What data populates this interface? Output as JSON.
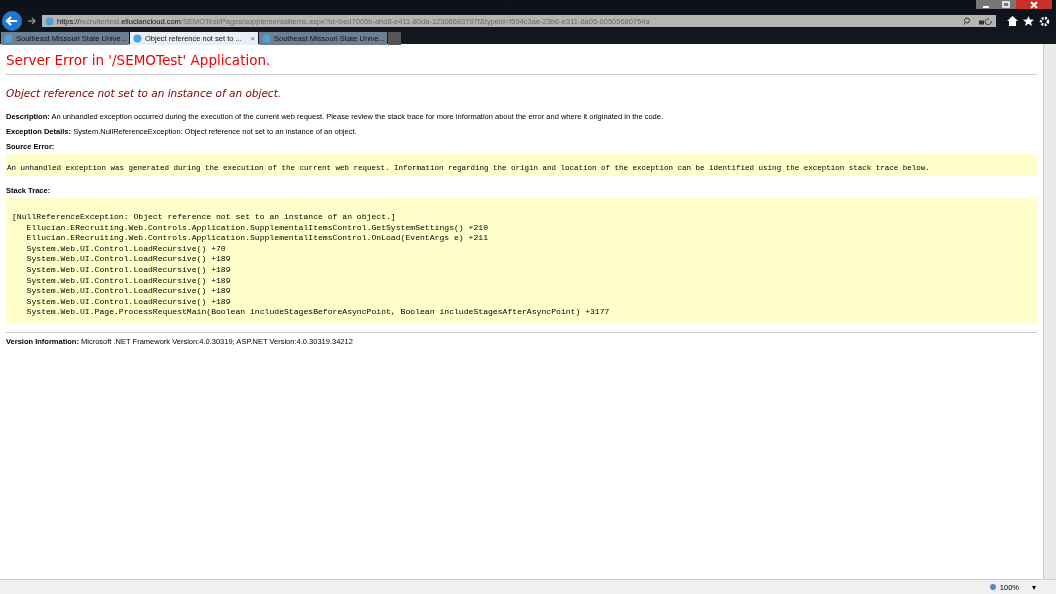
{
  "address_bar": {
    "url_scheme": "https://",
    "url_domain_prefix": "recruitertest.",
    "url_domain": "elluciancloud.com",
    "url_path": "/SEMOTest/Pages/supplementalitems.aspx?id=bed7005b-ahd8-e411-80da-12306683797f&typeid=f594c3ae-23b6-e311-8a05-00505680754a"
  },
  "tabs": [
    {
      "label": "Southeast Missouri State Unive...",
      "selected": false
    },
    {
      "label": "Object reference not set to ...",
      "selected": true
    },
    {
      "label": "Southeast Missouri State Unive...",
      "selected": false
    }
  ],
  "tab_close": "×",
  "page": {
    "title": "Server Error in '/SEMOTest' Application.",
    "subtitle": "Object reference not set to an instance of an object.",
    "description_label": "Description:",
    "description": "An unhandled exception occurred during the execution of the current web request. Please review the stack trace for more information about the error and where it originated in the code.",
    "exception_label": "Exception Details:",
    "exception": "System.NullReferenceException: Object reference not set to an instance of an object.",
    "source_error_label": "Source Error:",
    "source_error": "An unhandled exception was generated during the execution of the current web request. Information regarding the origin and location of the exception can be identified using the exception stack trace below.",
    "stack_trace_label": "Stack Trace:",
    "stack_trace": [
      "[NullReferenceException: Object reference not set to an instance of an object.]",
      "   Ellucian.ERecruiting.Web.Controls.Application.SupplementalItemsControl.GetSystemSettings() +210",
      "   Ellucian.ERecruiting.Web.Controls.Application.SupplementalItemsControl.OnLoad(EventArgs e) +211",
      "   System.Web.UI.Control.LoadRecursive() +70",
      "   System.Web.UI.Control.LoadRecursive() +189",
      "   System.Web.UI.Control.LoadRecursive() +189",
      "   System.Web.UI.Control.LoadRecursive() +189",
      "   System.Web.UI.Control.LoadRecursive() +189",
      "   System.Web.UI.Control.LoadRecursive() +189",
      "   System.Web.UI.Page.ProcessRequestMain(Boolean includeStagesBeforeAsyncPoint, Boolean includeStagesAfterAsyncPoint) +3177"
    ],
    "version_label": "Version Information:",
    "version": "Microsoft .NET Framework Version:4.0.30319; ASP.NET Version:4.0.30319.34212"
  },
  "status_bar": {
    "zoom": "100%",
    "zoom_menu": "▾"
  }
}
